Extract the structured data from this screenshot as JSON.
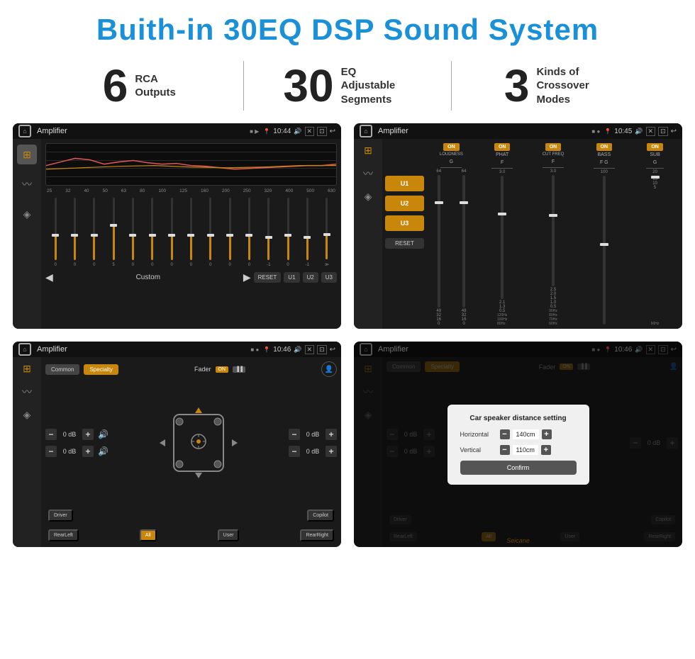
{
  "header": {
    "title": "Buith-in 30EQ DSP Sound System"
  },
  "stats": [
    {
      "number": "6",
      "label": "RCA\nOutputs",
      "label_line1": "RCA",
      "label_line2": "Outputs"
    },
    {
      "number": "30",
      "label": "EQ Adjustable\nSegments",
      "label_line1": "EQ Adjustable",
      "label_line2": "Segments"
    },
    {
      "number": "3",
      "label": "Kinds of\nCrossover Modes",
      "label_line1": "Kinds of",
      "label_line2": "Crossover Modes"
    }
  ],
  "screen1": {
    "title": "Amplifier",
    "time": "10:44",
    "freq_labels": [
      "25",
      "32",
      "40",
      "50",
      "63",
      "80",
      "100",
      "125",
      "160",
      "200",
      "250",
      "320",
      "400",
      "500",
      "630"
    ],
    "slider_values": [
      "0",
      "0",
      "0",
      "5",
      "0",
      "0",
      "0",
      "0",
      "0",
      "0",
      "0",
      "-1",
      "0",
      "-1"
    ],
    "preset": "Custom",
    "presets": [
      "RESET",
      "U1",
      "U2",
      "U3"
    ]
  },
  "screen2": {
    "title": "Amplifier",
    "time": "10:45",
    "channels": [
      {
        "label": "LOUDNESS",
        "on": true,
        "sub": "G"
      },
      {
        "label": "PHAT",
        "on": true,
        "sub": "F"
      },
      {
        "label": "CUT FREQ",
        "on": true,
        "sub": "F"
      },
      {
        "label": "BASS",
        "on": true,
        "sub": "F G"
      },
      {
        "label": "SUB",
        "on": true,
        "sub": "G"
      }
    ],
    "u_buttons": [
      "U1",
      "U2",
      "U3"
    ],
    "reset_label": "RESET"
  },
  "screen3": {
    "title": "Amplifier",
    "time": "10:46",
    "tabs": [
      "Common",
      "Specialty"
    ],
    "fader_label": "Fader",
    "on_label": "ON",
    "db_rows": [
      {
        "left_val": "0 dB",
        "right_val": "0 dB"
      },
      {
        "left_val": "0 dB",
        "right_val": "0 dB"
      }
    ],
    "bottom_labels": [
      "Driver",
      "Copilot",
      "RearLeft",
      "All",
      "User",
      "RearRight"
    ]
  },
  "screen4": {
    "title": "Amplifier",
    "time": "10:46",
    "tabs": [
      "Common",
      "Specialty"
    ],
    "on_label": "ON",
    "dialog": {
      "title": "Car speaker distance setting",
      "horizontal_label": "Horizontal",
      "horizontal_value": "140cm",
      "vertical_label": "Vertical",
      "vertical_value": "110cm",
      "confirm_label": "Confirm",
      "right_db": "0 dB"
    },
    "bottom_labels": [
      "Driver",
      "Copilot",
      "RearLeft",
      "User",
      "RearRight"
    ]
  },
  "watermark": "Seicane",
  "accent_color": "#c8860a",
  "colors": {
    "bg_dark": "#1a1a1a",
    "sidebar_bg": "#222222",
    "status_bar": "#111111"
  }
}
